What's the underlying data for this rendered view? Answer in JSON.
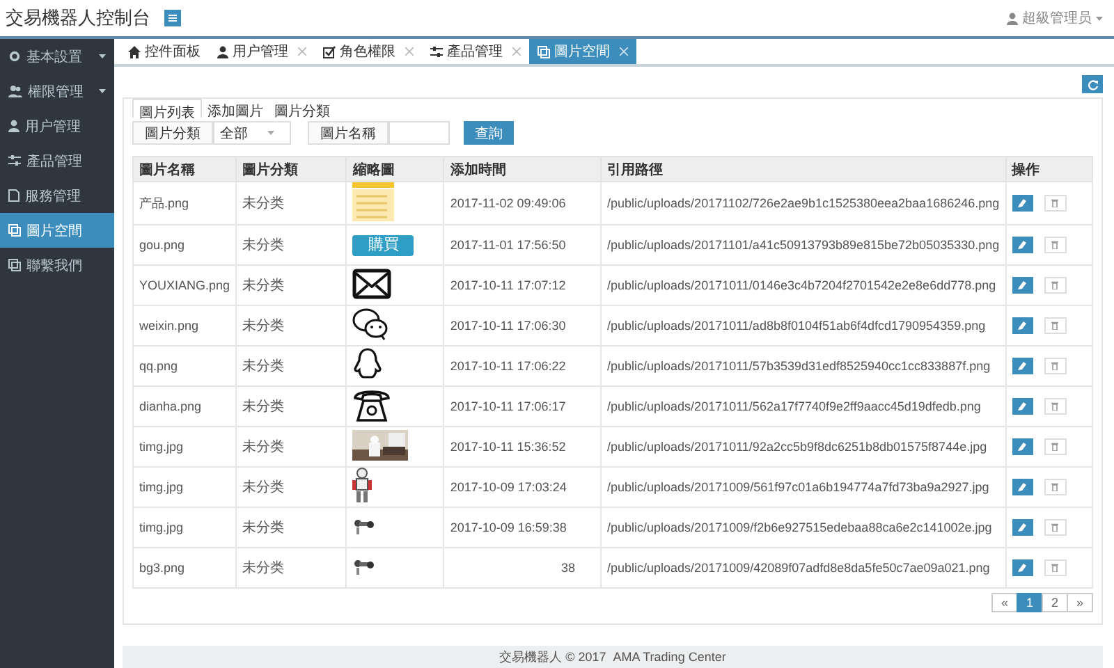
{
  "header": {
    "title": "交易機器人控制台",
    "user": "超級管理员"
  },
  "sidebar": {
    "items": [
      {
        "label": "基本設置",
        "has_submenu": true,
        "selected": false
      },
      {
        "label": "權限管理",
        "has_submenu": true,
        "selected": false
      },
      {
        "label": "用户管理",
        "has_submenu": false,
        "selected": false
      },
      {
        "label": "產品管理",
        "has_submenu": false,
        "selected": false
      },
      {
        "label": "服務管理",
        "has_submenu": false,
        "selected": false
      },
      {
        "label": "圖片空間",
        "has_submenu": false,
        "selected": true
      },
      {
        "label": "聯繫我們",
        "has_submenu": false,
        "selected": false
      }
    ]
  },
  "tabs": [
    {
      "label": "控件面板",
      "closable": false,
      "selected": false
    },
    {
      "label": "用户管理",
      "closable": true,
      "selected": false
    },
    {
      "label": "角色權限",
      "closable": true,
      "selected": false
    },
    {
      "label": "產品管理",
      "closable": true,
      "selected": false
    },
    {
      "label": "圖片空間",
      "closable": true,
      "selected": true
    }
  ],
  "inner_tabs": [
    {
      "label": "圖片列表",
      "selected": true
    },
    {
      "label": "添加圖片",
      "selected": false
    },
    {
      "label": "圖片分類",
      "selected": false
    }
  ],
  "filter": {
    "category_label": "圖片分類",
    "category_value": "全部",
    "name_label": "圖片名稱",
    "query_button": "查詢"
  },
  "table": {
    "columns": [
      "圖片名稱",
      "圖片分類",
      "縮略圖",
      "添加時間",
      "引用路徑",
      "操作"
    ],
    "rows": [
      {
        "name": "产品.png",
        "category": "未分类",
        "thumbnail": {
          "kind": "notes"
        },
        "time": "2017-11-02 09:49:06",
        "path": "/public/uploads/20171102/726e2ae9b1c1525380eea2baa1686246.png"
      },
      {
        "name": "gou.png",
        "category": "未分类",
        "thumbnail": {
          "kind": "button",
          "label": "購買"
        },
        "time": "2017-11-01 17:56:50",
        "path": "/public/uploads/20171101/a41c50913793b89e815be72b05035330.png"
      },
      {
        "name": "YOUXIANG.png",
        "category": "未分类",
        "thumbnail": {
          "kind": "envelope"
        },
        "time": "2017-10-11 17:07:12",
        "path": "/public/uploads/20171011/0146e3c4b7204f2701542e2e8e6dd778.png"
      },
      {
        "name": "weixin.png",
        "category": "未分类",
        "thumbnail": {
          "kind": "chat"
        },
        "time": "2017-10-11 17:06:30",
        "path": "/public/uploads/20171011/ad8b8f0104f51ab6f4dfcd1790954359.png"
      },
      {
        "name": "qq.png",
        "category": "未分类",
        "thumbnail": {
          "kind": "penguin"
        },
        "time": "2017-10-11 17:06:22",
        "path": "/public/uploads/20171011/57b3539d31edf8525940cc1cc833887f.png"
      },
      {
        "name": "dianha.png",
        "category": "未分类",
        "thumbnail": {
          "kind": "phone"
        },
        "time": "2017-10-11 17:06:17",
        "path": "/public/uploads/20171011/562a17f7740f9e2ff9aacc45d19dfedb.png"
      },
      {
        "name": "timg.jpg",
        "category": "未分类",
        "time": "2017-10-11 15:36:52",
        "path": "/public/uploads/20171011/92a2cc5b9f8dc6251b8db01575f8744e.jpg"
      },
      {
        "name": "timg.jpg",
        "category": "未分类",
        "thumbnail": {
          "kind": "robot"
        },
        "time": "2017-10-09 17:03:24",
        "path": "/public/uploads/20171009/561f97c01a6b194774a7fd73ba9a2927.jpg"
      },
      {
        "name": "timg.jpg",
        "category": "未分类",
        "thumbnail": {
          "kind": "robot-arm"
        },
        "time": "2017-10-09 16:59:38",
        "path": "/public/uploads/20171009/f2b6e927515edebaa88ca6e2c141002e.jpg"
      },
      {
        "name": "bg3.png",
        "category": "未分类",
        "thumbnail": {
          "kind": "robot-arm"
        },
        "time": "38",
        "path": "/public/uploads/20171009/42089f07adfd8e8da5fe50c7ae09a021.png"
      }
    ]
  },
  "pagination": {
    "prev": "«",
    "pages": [
      {
        "label": "1",
        "selected": true
      },
      {
        "label": "2",
        "selected": false
      }
    ],
    "next": "»"
  },
  "footer": "交易機器人 © 2017  AMA Trading Center"
}
